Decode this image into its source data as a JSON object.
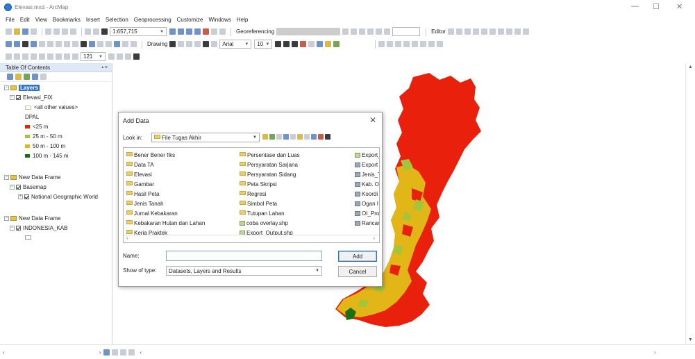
{
  "window": {
    "title": "Elevasi.mxd - ArcMap",
    "controls": [
      "—",
      "☐",
      "✕"
    ]
  },
  "menu": [
    "File",
    "Edit",
    "View",
    "Bookmarks",
    "Insert",
    "Selection",
    "Geoprocessing",
    "Customize",
    "Windows",
    "Help"
  ],
  "toolbar": {
    "scale": "1:657,715",
    "georeferencing": "Georeferencing",
    "editor": "Editor",
    "drawing": "Drawing",
    "font": "Arial",
    "font_size": "10",
    "zoom": "121"
  },
  "toc": {
    "title": "Table Of Contents",
    "pin": "▪ ×",
    "items": {
      "layers": "Layers",
      "elevasi": "Elevasi_FIX",
      "other": "<all other values>",
      "dpal": "DPAL",
      "c1": "<25 m",
      "c2": "25 m - 50 m",
      "c3": "50 m - 100 m",
      "c4": "100 m - 145 m",
      "frame1": "New Data Frame",
      "basemap": "Basemap",
      "natgeo": "National Geographic World",
      "frame2": "New Data Frame",
      "indonesia": "INDONESIA_KAB"
    },
    "colors": {
      "c1": "#e8200c",
      "c2": "#a4c43a",
      "c3": "#e3b618",
      "c4": "#1b6e12"
    }
  },
  "dialog": {
    "title": "Add Data",
    "close": "✕",
    "look_in_label": "Look in:",
    "look_in_value": "File Tugas Akhir",
    "col1": [
      "Bener Bener fiks",
      "Data TA",
      "Elevasi",
      "Gambar",
      "Hasil Peta",
      "Jenis Tanah",
      "Jurnal Kebakaran",
      "Kebakaran Hutan dan Lahan",
      "Kerja Praktek"
    ],
    "col2": [
      "Persentase dan Luas",
      "Persyaratan Sarjana",
      "Persyaratan Sidang",
      "Peta Skripsi",
      "Regresi",
      "Simbol Peta",
      "Tutupan Lahan",
      "coba overlay.shp",
      "Export_Output.shp"
    ],
    "col3": [
      "Export_",
      "Export",
      "Jenis_T",
      "Kab. O",
      "Koordi",
      "Ogan I",
      "OI_Pro",
      "Rancar"
    ],
    "name_label": "Name:",
    "name_value": "",
    "type_label": "Show of type:",
    "type_value": "Datasets, Layers and Results",
    "add_button": "Add",
    "cancel_button": "Cancel"
  }
}
